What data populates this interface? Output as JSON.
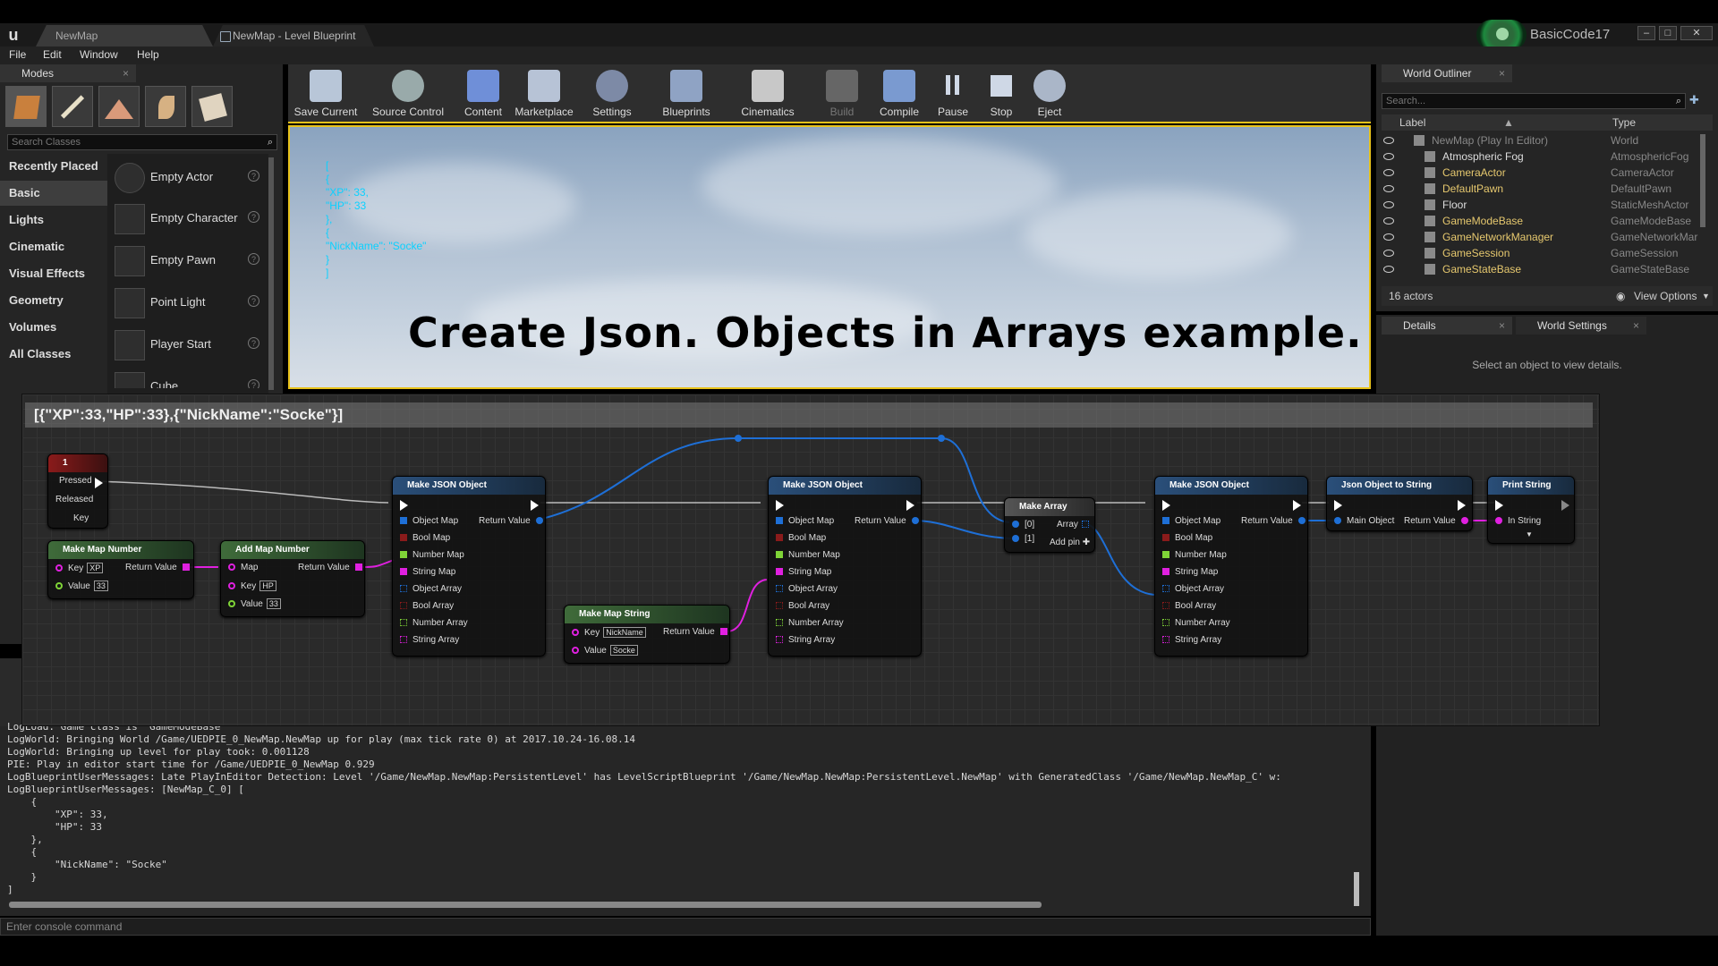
{
  "titlebar": {
    "tabs": [
      "NewMap",
      "NewMap - Level Blueprint"
    ],
    "user": "BasicCode17"
  },
  "menu": [
    "File",
    "Edit",
    "Window",
    "Help"
  ],
  "modes": {
    "title": "Modes",
    "search_placeholder": "Search Classes",
    "categories": [
      "Recently Placed",
      "Basic",
      "Lights",
      "Cinematic",
      "Visual Effects",
      "Geometry",
      "Volumes",
      "All Classes"
    ],
    "selected_category": "Basic",
    "items": [
      "Empty Actor",
      "Empty Character",
      "Empty Pawn",
      "Point Light",
      "Player Start",
      "Cube"
    ]
  },
  "toolbar": {
    "buttons": [
      "Save Current",
      "Source Control",
      "Content",
      "Marketplace",
      "Settings",
      "Blueprints",
      "Cinematics",
      "Build",
      "Compile",
      "Pause",
      "Stop",
      "Eject"
    ]
  },
  "viewport": {
    "json_output": "[\n{\n\"XP\": 33,\n\"HP\": 33\n},\n{\n\"NickName\": \"Socke\"\n}\n]",
    "title": "Create Json. Objects in Arrays example."
  },
  "outliner": {
    "title": "World Outliner",
    "search_placeholder": "Search...",
    "col_label": "Label",
    "col_type": "Type",
    "rows": [
      {
        "label": "NewMap (Play In Editor)",
        "type": "World"
      },
      {
        "label": "Atmospheric Fog",
        "type": "AtmosphericFog"
      },
      {
        "label": "CameraActor",
        "type": "CameraActor"
      },
      {
        "label": "DefaultPawn",
        "type": "DefaultPawn"
      },
      {
        "label": "Floor",
        "type": "StaticMeshActor"
      },
      {
        "label": "GameModeBase",
        "type": "GameModeBase"
      },
      {
        "label": "GameNetworkManager",
        "type": "GameNetworkMar"
      },
      {
        "label": "GameSession",
        "type": "GameSession"
      },
      {
        "label": "GameStateBase",
        "type": "GameStateBase"
      }
    ],
    "count": "16 actors",
    "view_options": "View Options"
  },
  "details": {
    "tab1": "Details",
    "tab2": "World Settings",
    "empty": "Select an object to view details."
  },
  "blueprint": {
    "header": "[{\"XP\":33,\"HP\":33},{\"NickName\":\"Socke\"}]",
    "key_event": {
      "title": "1",
      "pins": [
        "Pressed",
        "Released",
        "Key"
      ]
    },
    "make_map_number": {
      "title": "Make Map Number",
      "key_label": "Key",
      "key": "XP",
      "value_label": "Value",
      "value": "33",
      "out": "Return Value"
    },
    "add_map_number": {
      "title": "Add Map Number",
      "map": "Map",
      "key_label": "Key",
      "key": "HP",
      "value_label": "Value",
      "value": "33",
      "out": "Return Value"
    },
    "make_map_string": {
      "title": "Make Map String",
      "key_label": "Key",
      "key": "NickName",
      "value_label": "Value",
      "value": "Socke",
      "out": "Return Value"
    },
    "make_json_title": "Make JSON Object",
    "make_json_pins": [
      "Object Map",
      "Bool Map",
      "Number Map",
      "String Map",
      "Object Array",
      "Bool Array",
      "Number Array",
      "String Array"
    ],
    "return_value": "Return Value",
    "make_array": {
      "title": "Make Array",
      "in0": "[0]",
      "in1": "[1]",
      "out": "Array",
      "add": "Add pin"
    },
    "json_to_string": {
      "title": "Json Object to String",
      "in": "Main Object",
      "out": "Return Value"
    },
    "print_string": {
      "title": "Print String",
      "in": "In String"
    }
  },
  "console": {
    "log": "LogLoad: Game class is 'GameModeBase'\nLogWorld: Bringing World /Game/UEDPIE_0_NewMap.NewMap up for play (max tick rate 0) at 2017.10.24-16.08.14\nLogWorld: Bringing up level for play took: 0.001128\nPIE: Play in editor start time for /Game/UEDPIE_0_NewMap 0.929\nLogBlueprintUserMessages: Late PlayInEditor Detection: Level '/Game/NewMap.NewMap:PersistentLevel' has LevelScriptBlueprint '/Game/NewMap.NewMap:PersistentLevel.NewMap' with GeneratedClass '/Game/NewMap.NewMap_C' w:\nLogBlueprintUserMessages: [NewMap_C_0] [\n    {\n        \"XP\": 33,\n        \"HP\": 33\n    },\n    {\n        \"NickName\": \"Socke\"\n    }\n]",
    "placeholder": "Enter console command"
  }
}
